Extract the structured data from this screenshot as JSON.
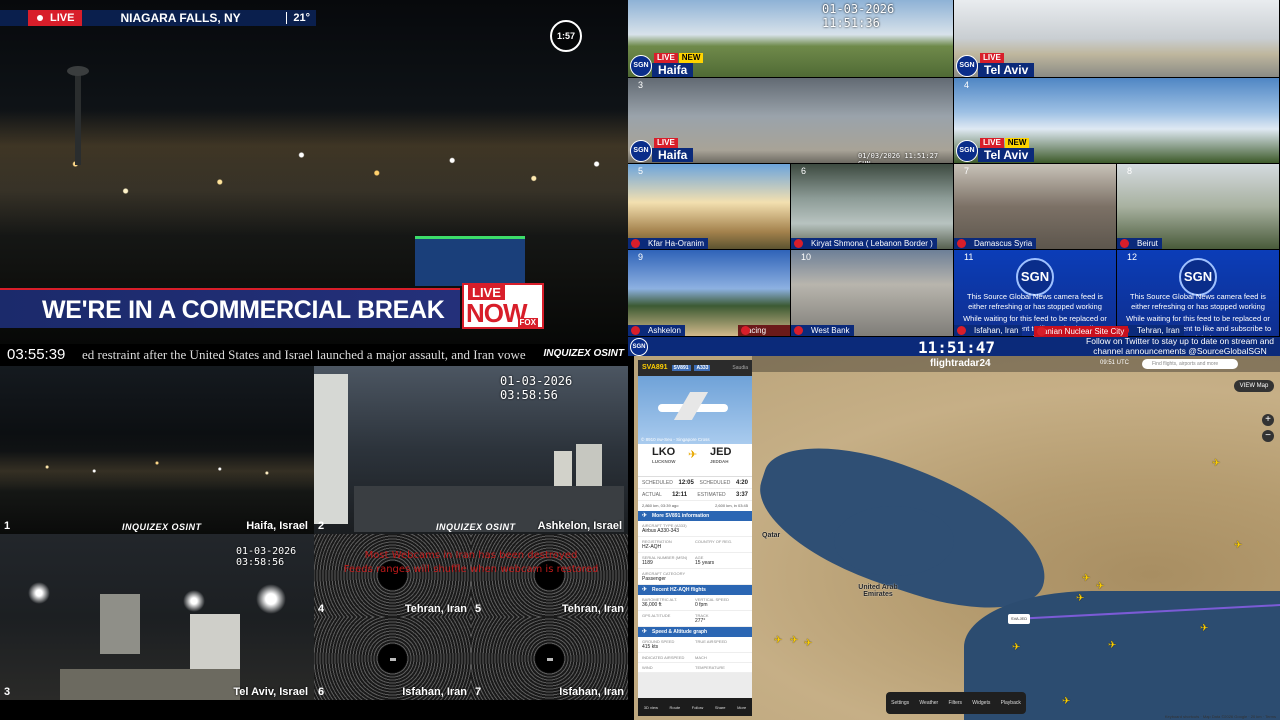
{
  "niagara": {
    "live": "LIVE",
    "city": "NIAGARA FALLS, NY",
    "temp": "21°",
    "timer": "1:57",
    "banner": "WE'RE IN A COMMERCIAL BREAK",
    "livenow_top": "LIVE",
    "livenow_main": "NOW",
    "livenow_brand": "FOX"
  },
  "grid": {
    "timestamp_top": "01-03-2026 11:51:36",
    "timestamp_mid": "01/03/2026 11:51:27 SUN",
    "cells": [
      {
        "num": "",
        "loc": "Haifa",
        "live": "LIVE",
        "new": "NEW"
      },
      {
        "num": "",
        "loc": "Tel Aviv",
        "live": "LIVE"
      },
      {
        "num": "3",
        "loc": "Haifa",
        "live": "LIVE"
      },
      {
        "num": "4",
        "loc": "Tel Aviv",
        "live": "LIVE",
        "new": "NEW"
      },
      {
        "num": "5",
        "loc": "Kfar Ha-Oranim"
      },
      {
        "num": "6",
        "loc": "Kiryat Shmona ( Lebanon Border )"
      },
      {
        "num": "7",
        "loc": "Damascus Syria"
      },
      {
        "num": "8",
        "loc": "Beirut"
      },
      {
        "num": "9",
        "loc": "Ashkelon",
        "loc2": "Facing Gaza"
      },
      {
        "num": "10",
        "loc": "West Bank"
      },
      {
        "num": "11",
        "loc": "Isfahan, Iran"
      },
      {
        "num": "12",
        "loc": "Tehran, Iran"
      }
    ],
    "sgn": "SGN",
    "sgn_msg_1": "This Source Global News camera feed is either refreshing or has stopped working",
    "sgn_msg_2": "While waiting for this feed to be replaced or fixed take a moment to like and subscribe to Source Global News",
    "ribbon_label": "Iranian Nuclear Site City",
    "clock": "11:51:47",
    "follow": "Follow on Twitter to stay up to date on stream and channel announcements @SourceGlobalSGN"
  },
  "night": {
    "clock": "03:55:39",
    "ticker": "ed restraint after the United States and Israel launched a major assault, and Iran vowe",
    "ticker_logo": "INQUIZEX OSINT",
    "ts1": "01-03-2026 03:58:56",
    "ts2": "01-03-2026 03:58:56",
    "err1": "Most Webcams in Iran has been destroyed",
    "err2": "Feeds ranges will shuffle when webcam is restored",
    "cams": [
      {
        "idx": "1",
        "loc": "Haifa, Israel"
      },
      {
        "idx": "2",
        "loc": "Ashkelon, Israel"
      },
      {
        "idx": "3",
        "loc": "Tel Aviv, Israel"
      },
      {
        "idx": "4",
        "loc": "Tehran, Iran"
      },
      {
        "idx": "5",
        "loc": "Tehran, Iran"
      },
      {
        "idx": "6",
        "loc": "Isfahan, Iran"
      },
      {
        "idx": "7",
        "loc": "Isfahan, Iran"
      }
    ],
    "osint": "INQUIZEX OSINT"
  },
  "flight": {
    "callsign": "SVA891",
    "badge1": "SV891",
    "badge2": "A333",
    "airline": "Saudia",
    "photo_caption": "© 8910 nw-Seu - Singapore Cross",
    "from_code": "LKO",
    "from_city": "LUCKNOW",
    "to_code": "JED",
    "to_city": "JEDDAH",
    "sched1_k": "SCHEDULED",
    "sched1_v": "12:05",
    "sched2_k": "SCHEDULED",
    "sched2_v": "4:20",
    "actual_k": "ACTUAL",
    "actual_v": "12:11",
    "estimated_k": "ESTIMATED",
    "estimated_v": "3:37",
    "progress": "2,860 km, 03:39 ago",
    "progress_right": "2,600 km, in 03:45",
    "section_info": "More SV891 information",
    "ac_type_k": "AIRCRAFT TYPE (A333)",
    "ac_type_v": "Airbus A330-343",
    "reg_k": "REGISTRATION",
    "reg_v": "HZ-AQH",
    "country_k": "COUNTRY OF REG.",
    "serial_k": "SERIAL NUMBER (MSN)",
    "serial_v": "1189",
    "age_k": "AGE",
    "age_v": "15 years",
    "cat_k": "AIRCRAFT CATEGORY",
    "cat_v": "Passenger",
    "section_recent": "Recent HZ-AQH flights",
    "baro_k": "BAROMETRIC ALT.",
    "baro_v": "36,000 ft",
    "vs_k": "VERTICAL SPEED",
    "vs_v": "0 fpm",
    "gps_k": "GPS ALTITUDE",
    "track_k": "TRACK",
    "track_v": "277°",
    "section_speed": "Speed & Altitude graph",
    "gs_k": "GROUND SPEED",
    "gs_v": "415 kts",
    "tas_k": "TRUE AIRSPEED",
    "ias_k": "INDICATED AIRSPEED",
    "mach_k": "MACH",
    "wind_k": "WIND",
    "temp_k": "TEMPERATURE",
    "toolbar": [
      "3D view",
      "Route",
      "Follow",
      "Share",
      "More"
    ],
    "logo": "flightradar24",
    "time": "09:51 UTC",
    "search": "Find flights, airports and more",
    "view": "VIEW  Map",
    "labels": {
      "qatar": "Qatar",
      "uae": "United Arab Emirates"
    },
    "selected": "SVA JED",
    "bottom": [
      "Settings",
      "Weather",
      "Filters",
      "Widgets",
      "Playback"
    ],
    "foot": "Keyboard shortcuts · Map Data ©2026 Google · 20 km · Terms"
  }
}
